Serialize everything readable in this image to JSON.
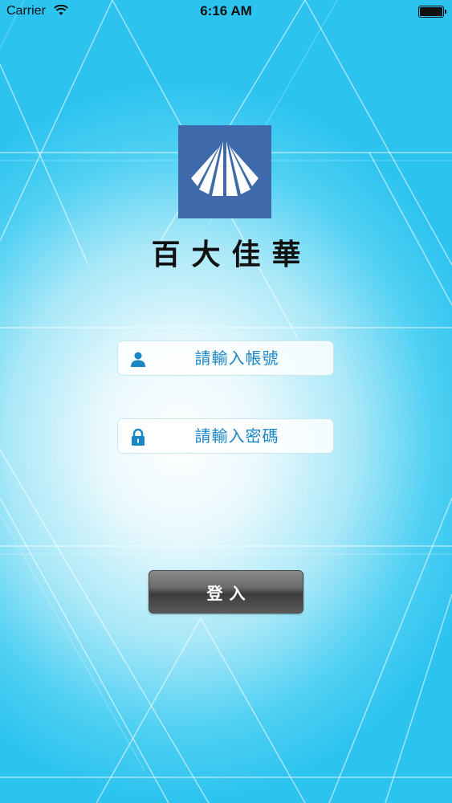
{
  "status_bar": {
    "carrier": "Carrier",
    "time": "6:16 AM"
  },
  "brand": {
    "name": "百大佳華",
    "logo_color": "#3e6aab"
  },
  "login_form": {
    "account_placeholder": "請輸入帳號",
    "password_placeholder": "請輸入密碼",
    "login_label": "登入",
    "accent_color": "#1a86c4"
  },
  "icons": {
    "account": "user-icon",
    "password": "lock-icon",
    "wifi": "wifi-icon",
    "battery": "battery-icon"
  }
}
